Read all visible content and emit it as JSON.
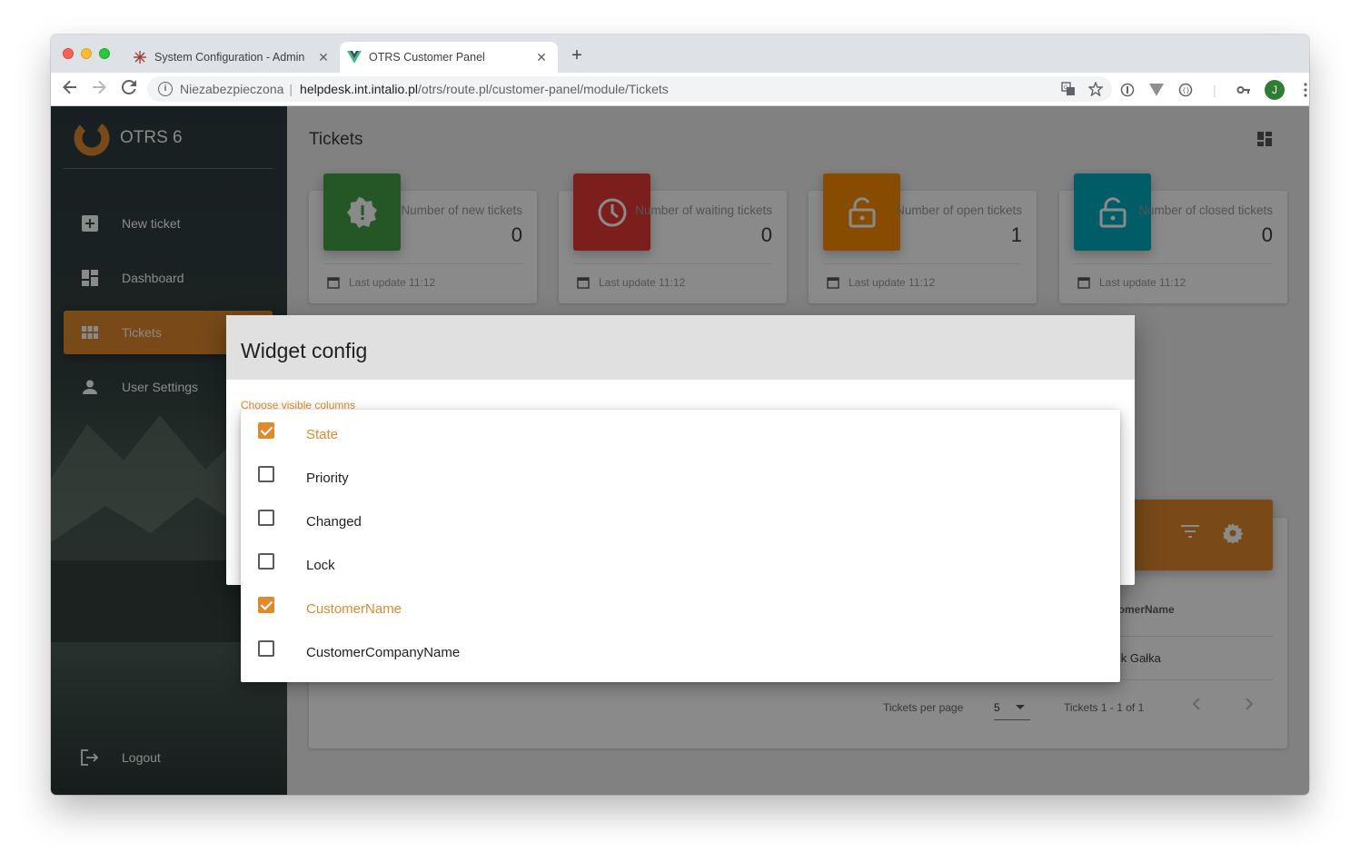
{
  "browser": {
    "tabs": [
      {
        "title": "System Configuration - Admin",
        "close": "✕",
        "active": false
      },
      {
        "title": "OTRS Customer Panel",
        "close": "✕",
        "active": true
      }
    ],
    "new_tab": "+",
    "address": {
      "security_label": "Niezabezpieczona",
      "separator": "|",
      "host": "helpdesk.int.intalio.pl",
      "path": "/otrs/route.pl/customer-panel/module/Tickets"
    },
    "profile_initial": "J"
  },
  "sidebar": {
    "brand": "OTRS 6",
    "items": [
      {
        "label": "New ticket",
        "icon": "plus-box-icon"
      },
      {
        "label": "Dashboard",
        "icon": "dashboard-icon"
      },
      {
        "label": "Tickets",
        "icon": "grid-icon",
        "active": true
      },
      {
        "label": "User Settings",
        "icon": "person-icon"
      }
    ],
    "logout": "Logout"
  },
  "main": {
    "title": "Tickets",
    "cards": [
      {
        "label": "Number of new tickets",
        "value": "0",
        "footer": "Last update 11:12",
        "color": "#43a047",
        "icon": "alert-badge-icon"
      },
      {
        "label": "Number of waiting tickets",
        "value": "0",
        "footer": "Last update 11:12",
        "color": "#e53935",
        "icon": "clock-icon"
      },
      {
        "label": "Number of open tickets",
        "value": "1",
        "footer": "Last update 11:12",
        "color": "#fb8c00",
        "icon": "lock-open-icon"
      },
      {
        "label": "Number of closed tickets",
        "value": "0",
        "footer": "Last update 11:12",
        "color": "#00acc1",
        "icon": "lock-open-icon"
      }
    ],
    "table": {
      "visible_column_header": "stomerName",
      "visible_cell": "cek Gałka",
      "per_page_label": "Tickets per page",
      "per_page_value": "5",
      "range": "Tickets 1 - 1 of 1"
    }
  },
  "dialog": {
    "title": "Widget config",
    "field_label": "Choose visible columns",
    "options": [
      {
        "label": "State",
        "checked": true
      },
      {
        "label": "Priority",
        "checked": false
      },
      {
        "label": "Changed",
        "checked": false
      },
      {
        "label": "Lock",
        "checked": false
      },
      {
        "label": "CustomerName",
        "checked": true
      },
      {
        "label": "CustomerCompanyName",
        "checked": false
      }
    ]
  },
  "colors": {
    "accent": "#e08a2e"
  }
}
